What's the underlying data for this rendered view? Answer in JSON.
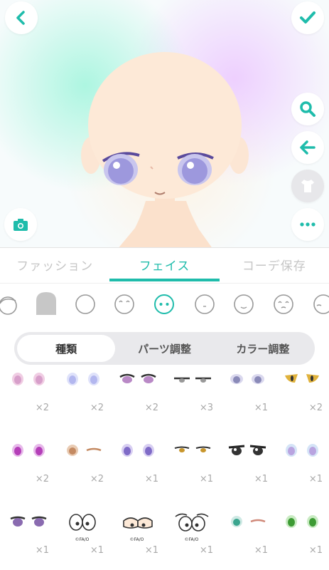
{
  "tabs": [
    {
      "label": "ファッション",
      "active": false
    },
    {
      "label": "フェイス",
      "active": true
    },
    {
      "label": "コーデ保存",
      "active": false
    }
  ],
  "segmented": [
    {
      "label": "種類",
      "active": true
    },
    {
      "label": "パーツ調整",
      "active": false
    },
    {
      "label": "カラー調整",
      "active": false
    }
  ],
  "toolbar": {
    "back_icon": "chevron-left-icon",
    "confirm_icon": "checkmark-icon",
    "zoom_icon": "search-icon",
    "undo_icon": "arrow-left-icon",
    "outfit_icon": "shirt-icon",
    "more_icon": "more-dots-icon",
    "camera_icon": "camera-icon"
  },
  "colors": {
    "accent": "#1fbcab",
    "inactive_text": "#c6c6c6"
  },
  "face_shapes": [
    "face-partial-left",
    "face-hair-gray",
    "face-plain",
    "face-smile",
    "face-selected",
    "face-small-mouth",
    "face-grin",
    "face-frown",
    "face-partial-right"
  ],
  "items": [
    {
      "count": "×2",
      "copy": ""
    },
    {
      "count": "×2",
      "copy": ""
    },
    {
      "count": "×2",
      "copy": ""
    },
    {
      "count": "×3",
      "copy": ""
    },
    {
      "count": "×1",
      "copy": ""
    },
    {
      "count": "×2",
      "copy": ""
    },
    {
      "count": "×2",
      "copy": ""
    },
    {
      "count": "×2",
      "copy": ""
    },
    {
      "count": "×1",
      "copy": ""
    },
    {
      "count": "×1",
      "copy": ""
    },
    {
      "count": "×1",
      "copy": ""
    },
    {
      "count": "×1",
      "copy": ""
    },
    {
      "count": "×1",
      "copy": ""
    },
    {
      "count": "×1",
      "copy": "©FA/O"
    },
    {
      "count": "×1",
      "copy": "©FA/O"
    },
    {
      "count": "×1",
      "copy": "©FA/O"
    },
    {
      "count": "×1",
      "copy": ""
    },
    {
      "count": "×1",
      "copy": ""
    }
  ]
}
